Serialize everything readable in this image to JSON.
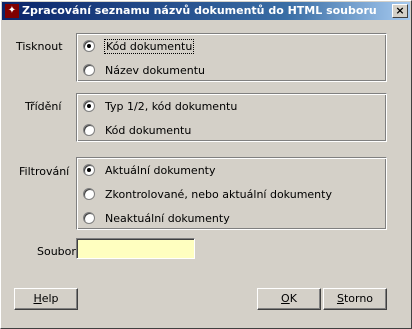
{
  "window": {
    "title": "Zpracování seznamu názvů dokumentů do HTML souboru",
    "icon": "app-icon",
    "icon_glyph": "✦",
    "close_glyph": "×"
  },
  "groups": {
    "tisknout": {
      "label": "Tisknout",
      "options": [
        {
          "label": "Kód dokumentu",
          "checked": true
        },
        {
          "label": "Název dokumentu",
          "checked": false
        }
      ]
    },
    "trideni": {
      "label": "Třídění",
      "options": [
        {
          "label": "Typ 1/2, kód dokumentu",
          "checked": true
        },
        {
          "label": "Kód dokumentu",
          "checked": false
        }
      ]
    },
    "filtrovani": {
      "label": "Filtrování",
      "options": [
        {
          "label": "Aktuální dokumenty",
          "checked": true
        },
        {
          "label": "Zkontrolované, nebo aktuální dokumenty",
          "checked": false
        },
        {
          "label": "Neaktuální dokumenty",
          "checked": false
        }
      ]
    }
  },
  "soubor": {
    "label": "Soubor",
    "value": ""
  },
  "buttons": {
    "help": {
      "mnemonic": "H",
      "rest": "elp"
    },
    "ok": {
      "mnemonic": "O",
      "rest": "K"
    },
    "storno": {
      "mnemonic": "S",
      "rest": "torno"
    }
  },
  "colors": {
    "input_bg": "#ffffc0",
    "face": "#d4d0c8",
    "title_from": "#0a246a"
  }
}
